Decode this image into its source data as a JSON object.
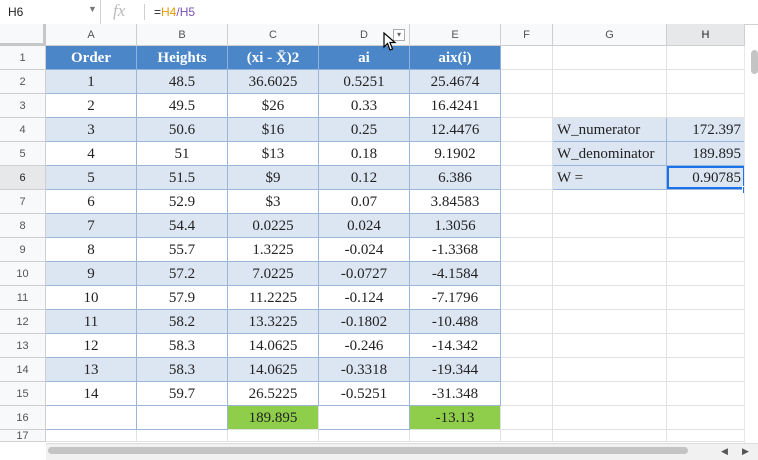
{
  "formula_bar": {
    "cell_ref": "H6",
    "fx_label": "fx",
    "formula_prefix": "=",
    "formula_ref1": "H4",
    "formula_op": "/",
    "formula_ref2": "H5"
  },
  "columns": [
    "A",
    "B",
    "C",
    "D",
    "E",
    "F",
    "G",
    "H"
  ],
  "rows": [
    "1",
    "2",
    "3",
    "4",
    "5",
    "6",
    "7",
    "8",
    "9",
    "10",
    "11",
    "12",
    "13",
    "14",
    "15",
    "16",
    "17"
  ],
  "table": {
    "headers": [
      "Order",
      "Heights",
      "(xi - X̄)2",
      "ai",
      "aix(i)"
    ],
    "data": [
      [
        "1",
        "48.5",
        "36.6025",
        "0.5251",
        "25.4674"
      ],
      [
        "2",
        "49.5",
        "$26",
        "0.33",
        "16.4241"
      ],
      [
        "3",
        "50.6",
        "$16",
        "0.25",
        "12.4476"
      ],
      [
        "4",
        "51",
        "$13",
        "0.18",
        "9.1902"
      ],
      [
        "5",
        "51.5",
        "$9",
        "0.12",
        "6.386"
      ],
      [
        "6",
        "52.9",
        "$3",
        "0.07",
        "3.84583"
      ],
      [
        "7",
        "54.4",
        "0.0225",
        "0.024",
        "1.3056"
      ],
      [
        "8",
        "55.7",
        "1.3225",
        "-0.024",
        "-1.3368"
      ],
      [
        "9",
        "57.2",
        "7.0225",
        "-0.0727",
        "-4.1584"
      ],
      [
        "10",
        "57.9",
        "11.2225",
        "-0.124",
        "-7.1796"
      ],
      [
        "11",
        "58.2",
        "13.3225",
        "-0.1802",
        "-10.488"
      ],
      [
        "12",
        "58.3",
        "14.0625",
        "-0.246",
        "-14.342"
      ],
      [
        "13",
        "58.3",
        "14.0625",
        "-0.3318",
        "-19.344"
      ],
      [
        "14",
        "59.7",
        "26.5225",
        "-0.5251",
        "-31.348"
      ]
    ],
    "totals": {
      "c": "189.895",
      "e": "-13.13"
    }
  },
  "side": {
    "rows": [
      {
        "label": "W_numerator",
        "value": "172.397"
      },
      {
        "label": "W_denominator",
        "value": "189.895"
      },
      {
        "label": "W =",
        "value": "0.90785"
      }
    ]
  },
  "colors": {
    "header": "#4a86c8",
    "alt_row": "#dce6f2",
    "total": "#8fce4b",
    "selection": "#1a73e8"
  }
}
